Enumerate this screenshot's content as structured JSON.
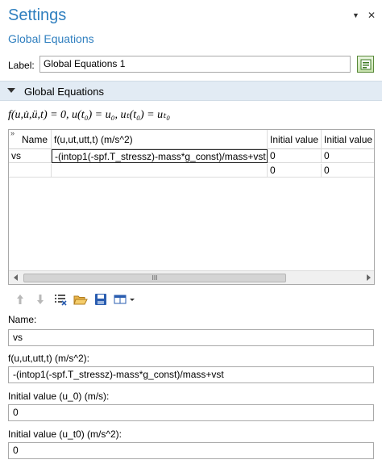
{
  "header": {
    "title": "Settings",
    "subtitle": "Global Equations",
    "pin_icon": "pin-icon",
    "close_icon": "close-icon"
  },
  "label_row": {
    "label": "Label:",
    "value": "Global Equations 1",
    "button_icon": "edit-node-icon"
  },
  "section": {
    "title": "Global Equations"
  },
  "equation_text": "f(u,u̇,ü,t) = 0, u(t₀) = u₀, uₜ(t₀) = uₜ₀",
  "table": {
    "columns": [
      "Name",
      "f(u,ut,utt,t) (m/s^2)",
      "Initial value",
      "Initial value"
    ],
    "rows": [
      [
        "vs",
        "-(intop1(-spf.T_stressz)-mass*g_const)/mass+vst",
        "0",
        "0"
      ],
      [
        "",
        "",
        "0",
        "0"
      ]
    ],
    "scroll_thumb_label": "III"
  },
  "toolbar": {
    "icons": [
      "move-up-icon",
      "move-down-icon",
      "clear-table-icon",
      "load-from-file-icon",
      "save-to-file-icon",
      "table-options-icon"
    ]
  },
  "fields": {
    "name_label": "Name:",
    "name_value": "vs",
    "f_label": "f(u,ut,utt,t) (m/s^2):",
    "f_value": "-(intop1(-spf.T_stressz)-mass*g_const)/mass+vst",
    "init0_label": "Initial value (u_0) (m/s):",
    "init0_value": "0",
    "init1_label": "Initial value (u_t0) (m/s^2):",
    "init1_value": "0"
  },
  "colors": {
    "accent": "#2f7fbf",
    "section_bg": "#e2ebf4"
  }
}
